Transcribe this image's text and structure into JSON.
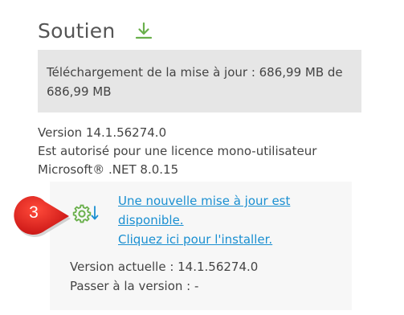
{
  "section": {
    "title": "Soutien",
    "download_icon": "download-icon"
  },
  "progress": {
    "text_line1": "Téléchargement de la mise à jour : 686,99 MB de",
    "text_line2": "686,99 MB"
  },
  "info": {
    "version": "Version 14.1.56274.0",
    "license": "Est autorisé pour une licence mono-utilisateur",
    "runtime": "Microsoft® .NET 8.0.15"
  },
  "update": {
    "icon": "gear-download-icon",
    "link_line1": "Une nouvelle mise à jour est",
    "link_line2": "disponible.",
    "install_link": "Cliquez ici pour l'installer.",
    "current_version": "Version actuelle : 14.1.56274.0",
    "target_version": "Passer à la version : -"
  },
  "callout": {
    "number": "3"
  },
  "colors": {
    "accent_green": "#6ab04c",
    "link_blue": "#1a8fd1",
    "callout_red": "#e02020"
  }
}
